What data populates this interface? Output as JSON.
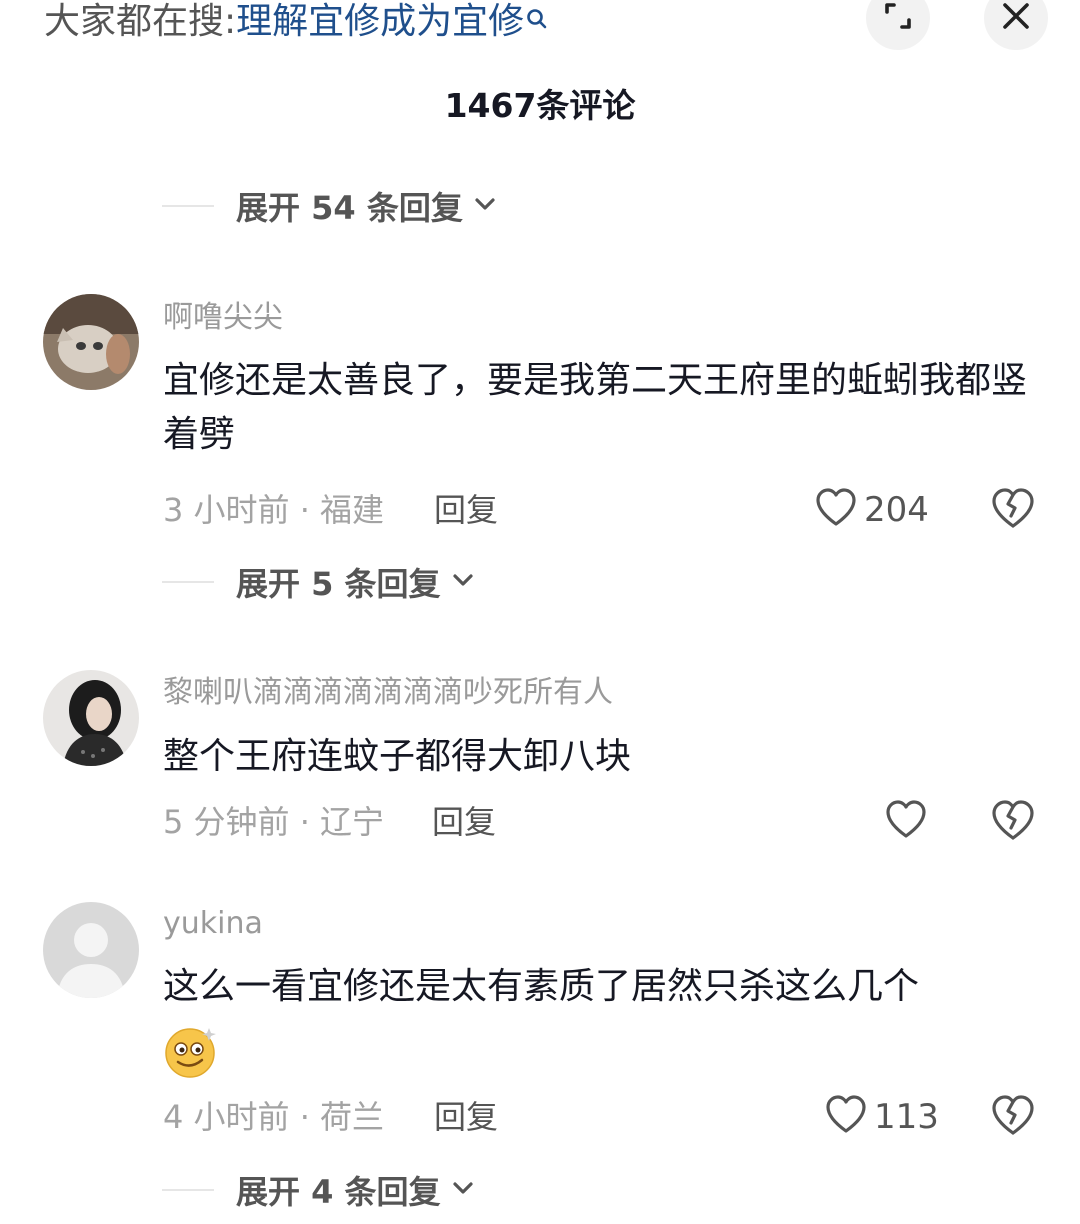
{
  "header": {
    "search_prefix": "大家都在搜:",
    "search_keyword": "理解宜修成为宜修",
    "comment_count_title": "1467条评论"
  },
  "threads": [
    {
      "expand_label": "展开 54 条回复"
    },
    {
      "username": "啊噜尖尖",
      "text": "宜修还是太善良了，要是我第二天王府里的蚯蚓我都竖着劈",
      "time_location": "3 小时前 · 福建",
      "reply_label": "回复",
      "likes": "204",
      "expand_label": "展开 5 条回复"
    },
    {
      "username": "黎喇叭滴滴滴滴滴滴滴吵死所有人",
      "text": "整个王府连蚊子都得大卸八块",
      "time_location": "5 分钟前 · 辽宁",
      "reply_label": "回复",
      "likes": ""
    },
    {
      "username": "yukina",
      "text": "这么一看宜修还是太有素质了居然只杀这么几个",
      "time_location": "4 小时前 · 荷兰",
      "reply_label": "回复",
      "likes": "113",
      "expand_label": "展开 4 条回复"
    }
  ],
  "icons": {
    "search": "search-icon",
    "expand": "expand-icon",
    "close": "close-icon",
    "chevron": "chevron-down-icon",
    "like": "heart-icon",
    "dislike": "broken-heart-icon",
    "emoji": "dizzy-face-emoji"
  },
  "colors": {
    "keyword": "#1f4f8c",
    "text": "#161823",
    "meta": "#a3a3a3"
  }
}
